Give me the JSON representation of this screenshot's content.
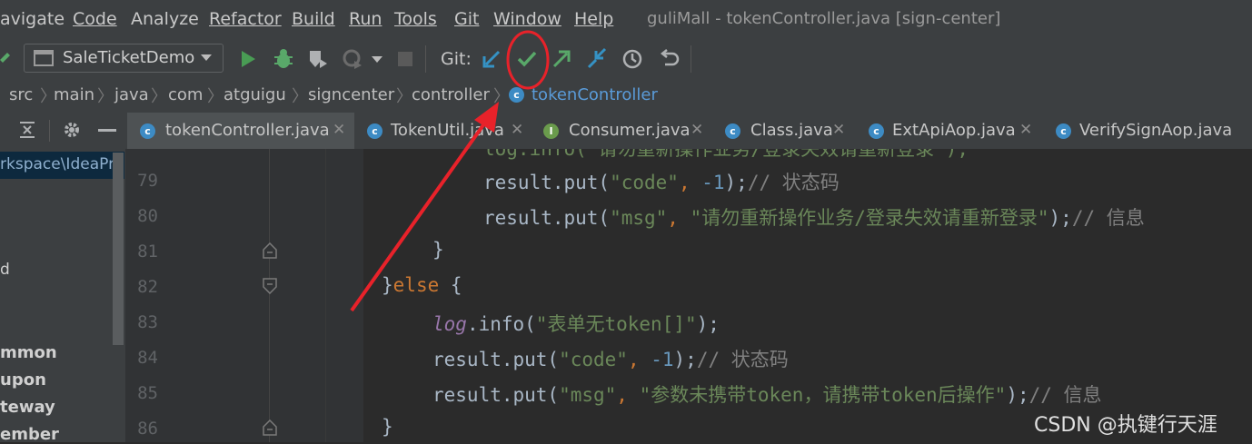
{
  "menu": [
    "avigate",
    "Code",
    "Analyze",
    "Refactor",
    "Build",
    "Run",
    "Tools",
    "Git",
    "Window",
    "Help"
  ],
  "window_title": "guliMall - tokenController.java [sign-center]",
  "toolbar": {
    "run_config": "SaleTicketDemo",
    "git_label": "Git:"
  },
  "breadcrumb": [
    "src",
    "main",
    "java",
    "com",
    "atguigu",
    "signcenter",
    "controller",
    "tokenController"
  ],
  "tabs": [
    {
      "label": "tokenController.java",
      "icon": "C"
    },
    {
      "label": "TokenUtil.java",
      "icon": "C"
    },
    {
      "label": "Consumer.java",
      "icon": "I"
    },
    {
      "label": "Class.java",
      "icon": "C"
    },
    {
      "label": "ExtApiAop.java",
      "icon": "C"
    },
    {
      "label": "VerifySignAop.java",
      "icon": "C"
    }
  ],
  "left_panel": {
    "path": "rkspace\\IdeaPro",
    "items": [
      "d",
      "mmon",
      "upon",
      "teway",
      "ember"
    ]
  },
  "line_numbers": [
    "79",
    "80",
    "81",
    "82",
    "83",
    "84",
    "85",
    "86"
  ],
  "code": {
    "l78a": "log.info(\"请勿重新操作业务/登录失效请重新登录\");",
    "l79": {
      "pre": "result.put(",
      "s": "\"code\"",
      "mid": ", ",
      "n": "-1",
      "end": ");",
      "c": "// 状态码"
    },
    "l80": {
      "pre": "result.put(",
      "s": "\"msg\"",
      "mid": ", ",
      "s2": "\"请勿重新操作业务/登录失效请重新登录\"",
      "end": ");",
      "c": "// 信息"
    },
    "l81": "}",
    "l82": {
      "brace": "}",
      "kw": "else",
      "rest": " {"
    },
    "l83": {
      "fld": "log",
      "pre": ".info(",
      "s": "\"表单无token[]\"",
      "end": ");"
    },
    "l84": {
      "pre": "result.put(",
      "s": "\"code\"",
      "mid": ", ",
      "n": "-1",
      "end": ");",
      "c": "// 状态码"
    },
    "l85": {
      "pre": "result.put(",
      "s": "\"msg\"",
      "mid": ", ",
      "s2": "\"参数未携带token，请携带token后操作\"",
      "end": ");",
      "c": "// 信息"
    },
    "l86": "}"
  },
  "watermark": "CSDN @执键行天涯",
  "colors": {
    "accent": "#4a88c7",
    "annotation": "#e8222a",
    "keyword": "#cc7832",
    "string": "#6a8759",
    "number": "#6897bb"
  }
}
